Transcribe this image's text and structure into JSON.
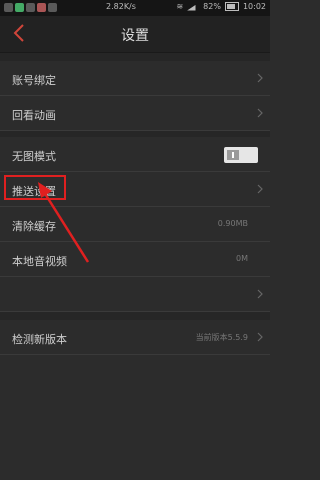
{
  "status_bar": {
    "speed": "2.82K/s",
    "battery_percent": "82%",
    "time": "10:02"
  },
  "header": {
    "title": "设置"
  },
  "settings": {
    "account_binding": "账号绑定",
    "item_2": "回看动画",
    "night_mode": {
      "label": "无图模式",
      "enabled": false
    },
    "push_settings": "推送设置",
    "clear_cache": {
      "label": "清除缓存",
      "value": "0.90MB"
    },
    "local_video": {
      "label": "本地音视频",
      "value": "0M"
    },
    "item_7": "",
    "check_update": {
      "label": "检测新版本",
      "value": "当前版本5.5.9"
    }
  },
  "colors": {
    "highlight": "#e02020",
    "back_arrow": "#d0453a"
  }
}
